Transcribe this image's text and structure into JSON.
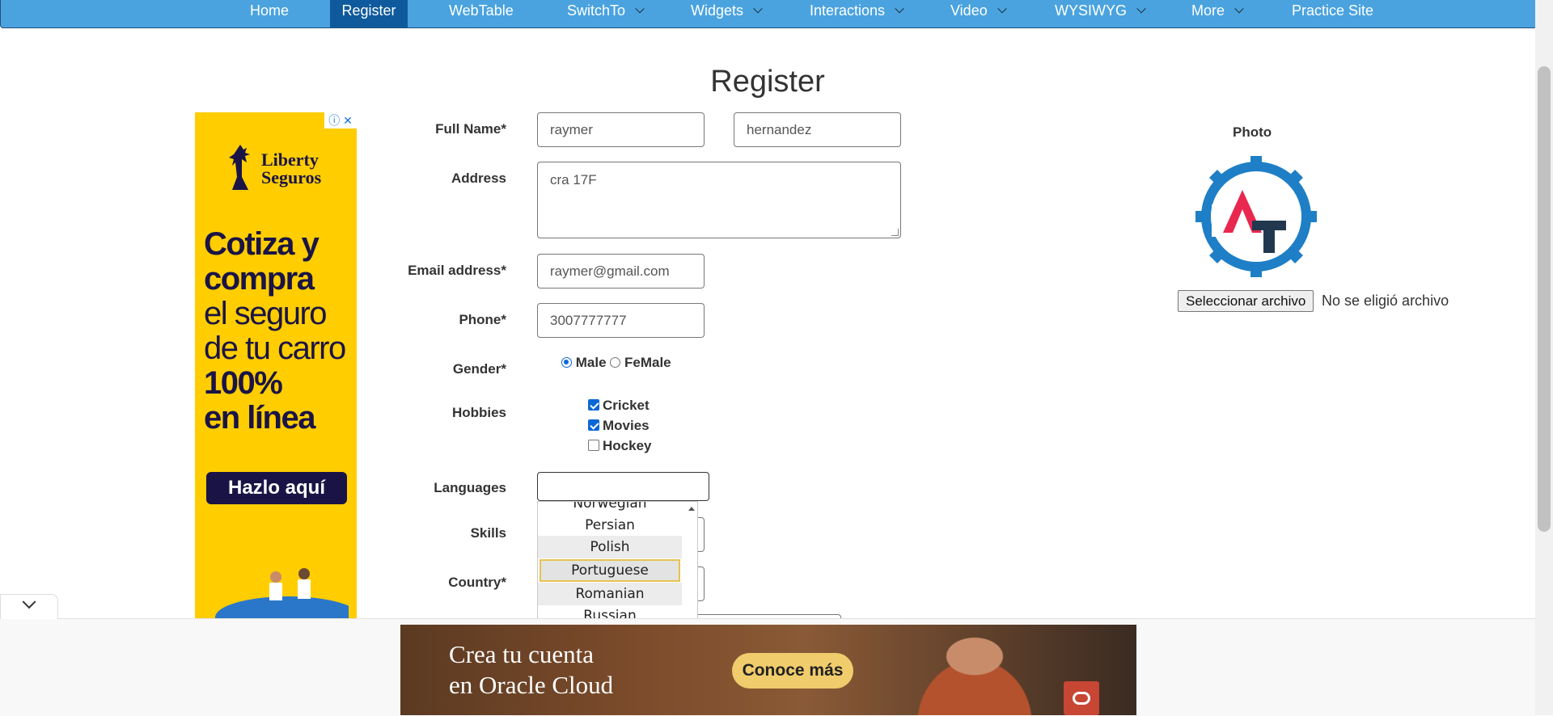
{
  "nav": {
    "items": [
      {
        "label": "Home",
        "active": false,
        "caret": false
      },
      {
        "label": "Register",
        "active": true,
        "caret": false
      },
      {
        "label": "WebTable",
        "active": false,
        "caret": false
      },
      {
        "label": "SwitchTo",
        "active": false,
        "caret": true
      },
      {
        "label": "Widgets",
        "active": false,
        "caret": true
      },
      {
        "label": "Interactions",
        "active": false,
        "caret": true
      },
      {
        "label": "Video",
        "active": false,
        "caret": true
      },
      {
        "label": "WYSIWYG",
        "active": false,
        "caret": true
      },
      {
        "label": "More",
        "active": false,
        "caret": true
      },
      {
        "label": "Practice Site",
        "active": false,
        "caret": false
      }
    ]
  },
  "page": {
    "title": "Register"
  },
  "form": {
    "full_name_label": "Full Name*",
    "first_name": "raymer",
    "last_name": "hernandez",
    "address_label": "Address",
    "address": "cra 17F",
    "email_label": "Email address*",
    "email": "raymer@gmail.com",
    "phone_label": "Phone*",
    "phone": "3007777777",
    "gender_label": "Gender*",
    "gender_male": "Male",
    "gender_female": "FeMale",
    "hobbies_label": "Hobbies",
    "hobby_cricket": "Cricket",
    "hobby_movies": "Movies",
    "hobby_hockey": "Hockey",
    "languages_label": "Languages",
    "skills_label": "Skills",
    "country_label": "Country*"
  },
  "languages": {
    "options": [
      "Norwegian",
      "Persian",
      "Polish",
      "Portuguese",
      "Romanian",
      "Russian"
    ],
    "selected": "Portuguese"
  },
  "photo": {
    "label": "Photo",
    "choose_button": "Seleccionar archivo",
    "no_file": "No se eligió archivo"
  },
  "ads": {
    "left": {
      "brand_line1": "Liberty",
      "brand_line2": "Seguros",
      "copy_bold1": "Cotiza y",
      "copy_bold2": "compra",
      "copy_reg1": "el seguro",
      "copy_reg2": "de tu carro",
      "copy_bold3": "100%",
      "copy_bold4": "en línea",
      "cta": "Hazlo aquí"
    },
    "bottom": {
      "line1": "Crea tu cuenta",
      "line2": "en Oracle Cloud",
      "cta": "Conoce más"
    }
  },
  "colors": {
    "nav_bg": "#4aa3df",
    "nav_active": "#0f5a9c",
    "logo_blue": "#1e7fc6",
    "logo_red": "#e8284e",
    "logo_dark": "#22384f"
  }
}
